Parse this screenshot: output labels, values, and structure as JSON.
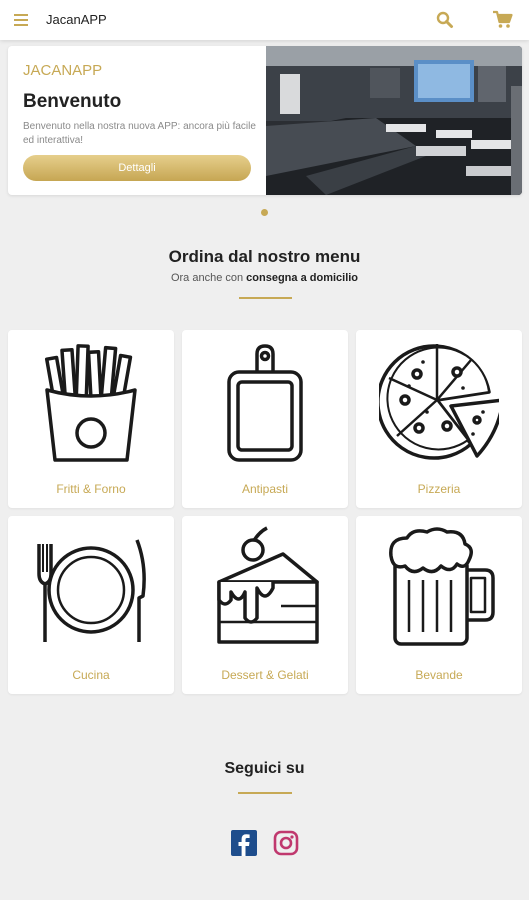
{
  "topbar": {
    "title": "JacanAPP"
  },
  "hero": {
    "brand": "JACANAPP",
    "welcome": "Benvenuto",
    "description": "Benvenuto nella nostra nuova APP: ancora più facile ed interattiva!",
    "button_label": "Dettagli"
  },
  "menu_section": {
    "title": "Ordina dal nostro menu",
    "subtitle_prefix": "Ora anche con ",
    "subtitle_bold": "consegna a domicilio"
  },
  "categories": [
    {
      "label": "Fritti & Forno",
      "icon": "fries-icon"
    },
    {
      "label": "Antipasti",
      "icon": "cutting-board-icon"
    },
    {
      "label": "Pizzeria",
      "icon": "pizza-icon"
    },
    {
      "label": "Cucina",
      "icon": "plate-cutlery-icon"
    },
    {
      "label": "Dessert & Gelati",
      "icon": "cake-icon"
    },
    {
      "label": "Bevande",
      "icon": "beer-icon"
    }
  ],
  "social": {
    "title": "Seguici su",
    "links": [
      "facebook-icon",
      "instagram-icon"
    ]
  },
  "colors": {
    "accent": "#c7a955",
    "background": "#efefef",
    "facebook": "#1e4d8c",
    "instagram": "#c0386e"
  }
}
